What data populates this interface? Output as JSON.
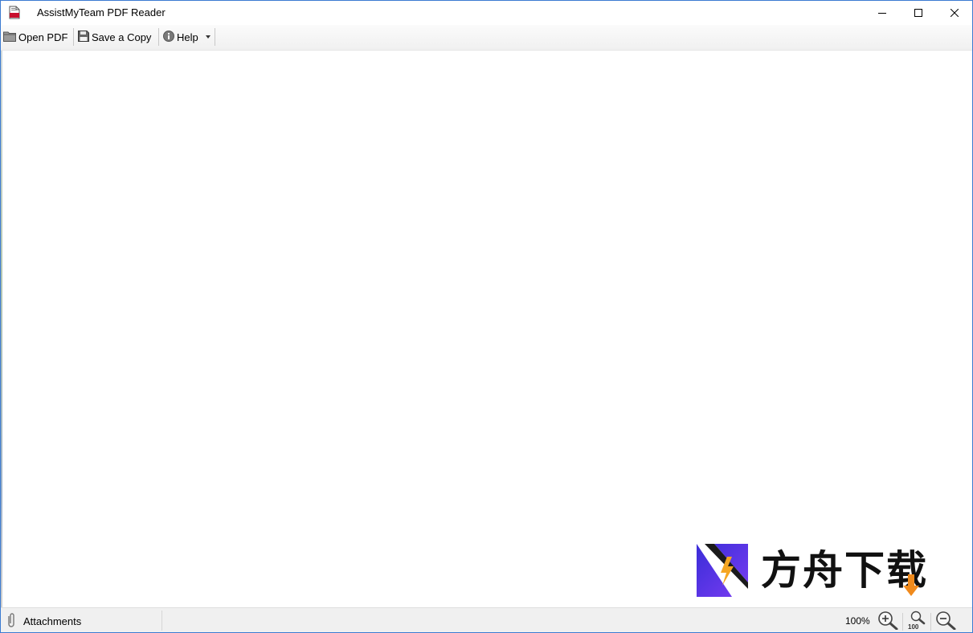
{
  "window": {
    "title": "AssistMyTeam PDF Reader",
    "app_icon": "pdf-file-icon",
    "controls": {
      "minimize_icon": "minimize-icon",
      "maximize_icon": "maximize-icon",
      "close_icon": "close-icon"
    }
  },
  "toolbar": {
    "open_label": "Open PDF",
    "open_icon": "folder-icon",
    "save_label": "Save a Copy",
    "save_icon": "floppy-disk-icon",
    "help_label": "Help",
    "help_icon": "info-icon"
  },
  "watermark": {
    "text": "方舟下载",
    "logo_colors": [
      "#3a2dd8",
      "#6a3cf0",
      "#ffffff"
    ],
    "arrow_color": "#f08a1c",
    "bolt_color": "#f5a623"
  },
  "statusbar": {
    "attachments_label": "Attachments",
    "attachments_icon": "paperclip-icon",
    "zoom_level": "100%",
    "zoom_in_icon": "zoom-in-icon",
    "zoom_100_icon": "zoom-100-icon",
    "zoom_100_label": "100",
    "zoom_out_icon": "zoom-out-icon"
  },
  "colors": {
    "window_border": "#3c7bd1",
    "toolbar_bg": "#f0f0f0",
    "statusbar_bg": "#f0f0f0"
  }
}
